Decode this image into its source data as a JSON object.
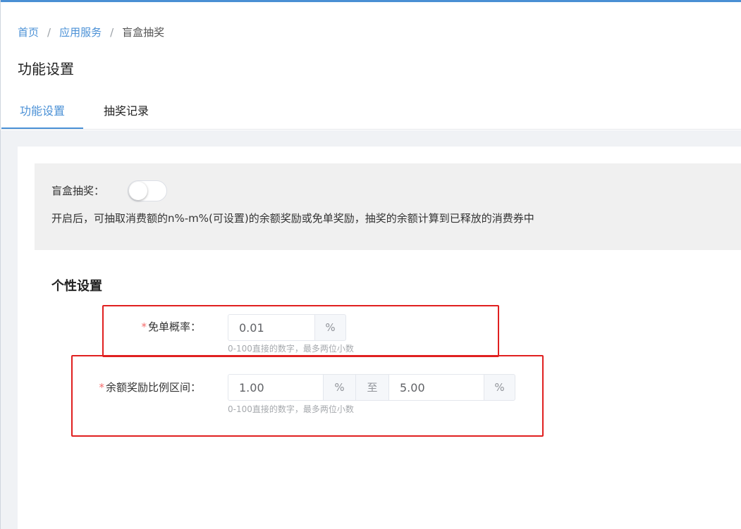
{
  "breadcrumb": {
    "items": [
      {
        "label": "首页"
      },
      {
        "label": "应用服务"
      },
      {
        "label": "盲盒抽奖"
      }
    ],
    "separator": "/"
  },
  "page": {
    "title": "功能设置"
  },
  "tabs": [
    {
      "label": "功能设置",
      "active": true
    },
    {
      "label": "抽奖记录",
      "active": false
    }
  ],
  "switch_panel": {
    "label": "盲盒抽奖：",
    "enabled": false,
    "description": "开启后，可抽取消费额的n%-m%(可设置)的余额奖励或免单奖励，抽奖的余额计算到已释放的消费券中"
  },
  "personal_settings": {
    "title": "个性设置",
    "required_mark": "*",
    "free_order_rate": {
      "label": "免单概率：",
      "value": "0.01",
      "unit": "%",
      "hint": "0-100直接的数字，最多两位小数"
    },
    "balance_range": {
      "label": "余额奖励比例区间：",
      "min_value": "1.00",
      "min_unit": "%",
      "to_label": "至",
      "max_value": "5.00",
      "max_unit": "%",
      "hint": "0-100直接的数字，最多两位小数"
    }
  },
  "colors": {
    "accent": "#4a90d6",
    "required": "#f56c6c",
    "annotation": "#e02020"
  }
}
